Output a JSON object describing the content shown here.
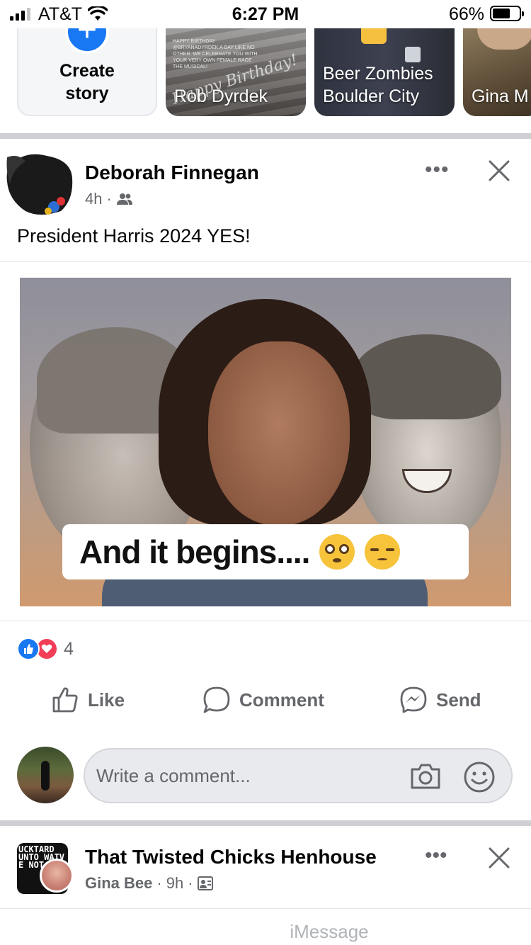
{
  "status_bar": {
    "carrier": "AT&T",
    "time": "6:27 PM",
    "battery_percent": "66%",
    "battery_level": 0.66
  },
  "stories": {
    "create_label_line1": "Create",
    "create_label_line2": "story",
    "items": [
      {
        "name": "Rob Dyrdek",
        "overlay_small": "HAPPY BIRTHDAY @BRYANADYRDEK A DAY LIKE NO OTHER. WE CELEBRATE YOU WITH YOUR VERY OWN FEMALE RAGE THE MUSICAL!",
        "overlay_script": "Happy Birthday!"
      },
      {
        "name": "Beer Zombies Boulder City"
      },
      {
        "name": "Gina M"
      }
    ]
  },
  "post": {
    "author": "Deborah Finnegan",
    "time": "4h",
    "audience_icon": "friends-icon",
    "text": "President Harris 2024 YES!",
    "image_caption": "And it begins....",
    "reaction_count": "4",
    "actions": {
      "like": "Like",
      "comment": "Comment",
      "send": "Send"
    },
    "comment_placeholder": "Write a comment..."
  },
  "next_post": {
    "page_name": "That Twisted Chicks Henhouse",
    "author": "Gina Bee",
    "time": "9h",
    "avatar_text": "UCKTARD UNTO WATV E NOT TO"
  },
  "keyboard_hint": "iMessage",
  "colors": {
    "accent": "#1877f2",
    "love": "#f33e58",
    "secondary_text": "#65676b",
    "divider": "#ced0d4"
  }
}
